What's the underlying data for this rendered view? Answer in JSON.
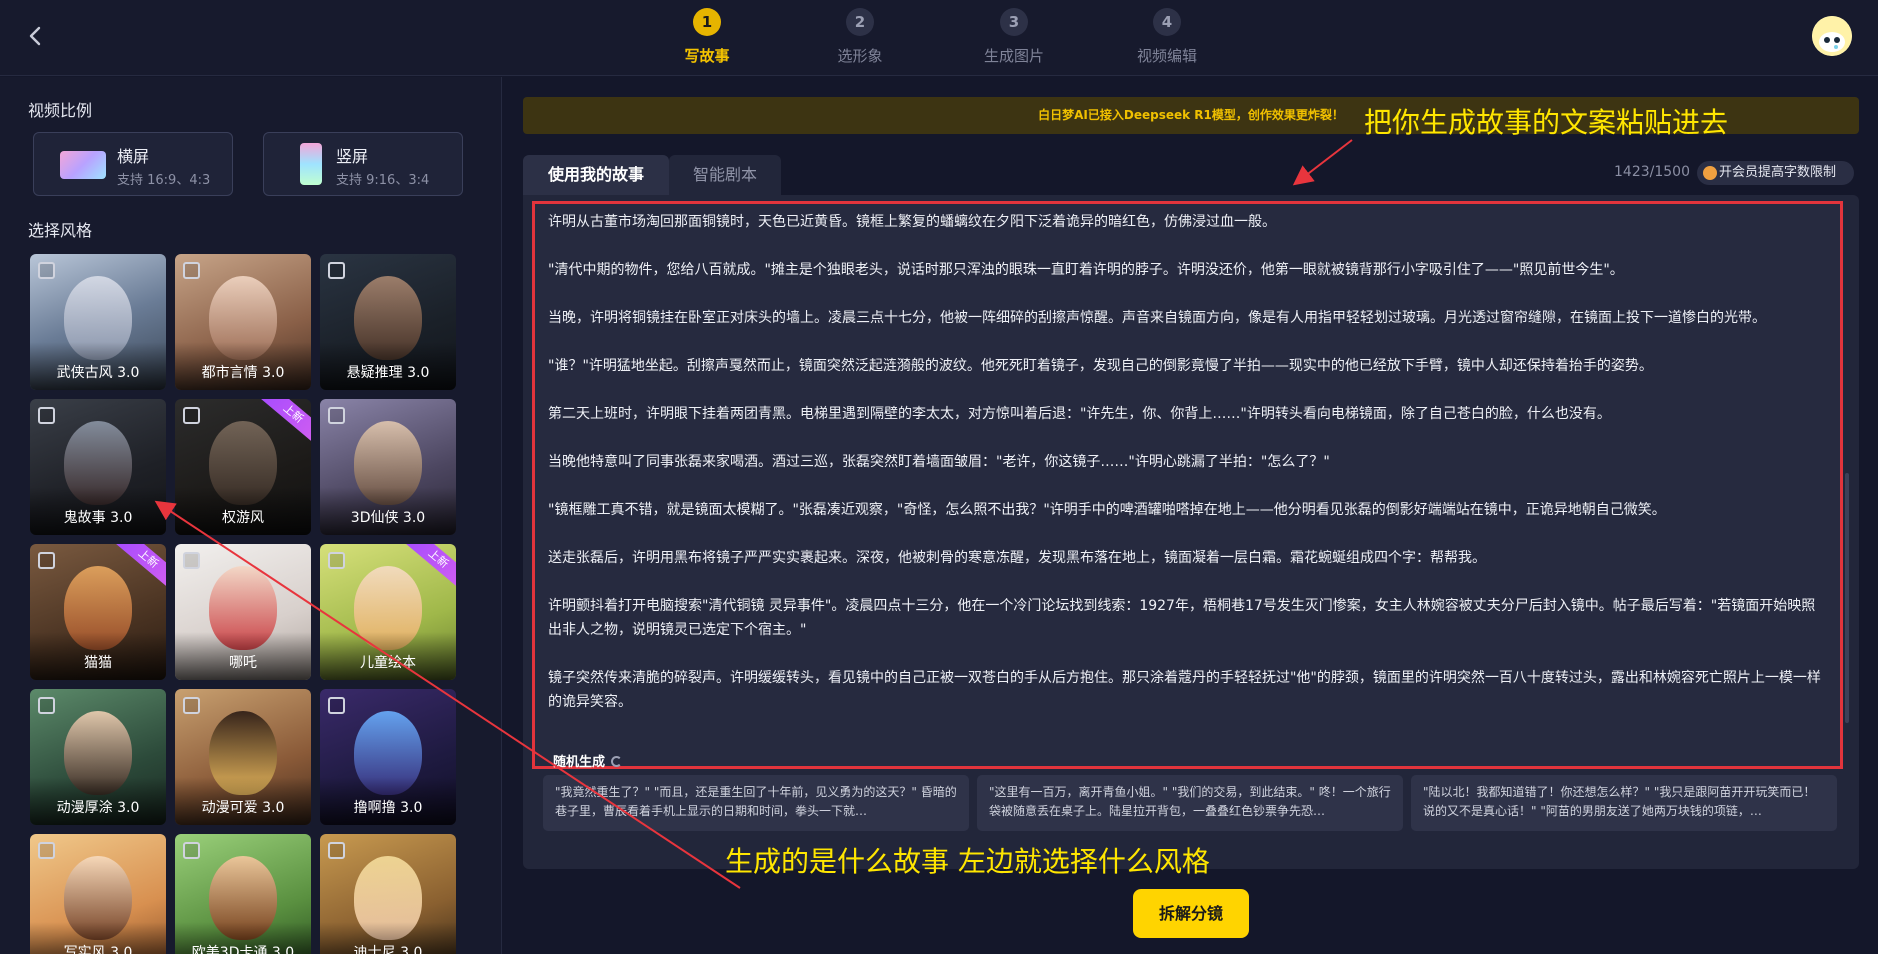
{
  "steps": [
    {
      "num": "1",
      "label": "写故事"
    },
    {
      "num": "2",
      "label": "选形象"
    },
    {
      "num": "3",
      "label": "生成图片"
    },
    {
      "num": "4",
      "label": "视频编辑"
    }
  ],
  "left": {
    "ratio_title": "视频比例",
    "ratios": [
      {
        "name": "横屏",
        "sub": "支持 16:9、4:3"
      },
      {
        "name": "竖屏",
        "sub": "支持 9:16、3:4"
      }
    ],
    "style_title": "选择风格",
    "styles": [
      {
        "label": "武侠古风 3.0",
        "badge": ""
      },
      {
        "label": "都市言情 3.0",
        "badge": ""
      },
      {
        "label": "悬疑推理 3.0",
        "badge": ""
      },
      {
        "label": "鬼故事 3.0",
        "badge": ""
      },
      {
        "label": "权游风",
        "badge": "上新"
      },
      {
        "label": "3D仙侠 3.0",
        "badge": ""
      },
      {
        "label": "猫猫",
        "badge": "上新"
      },
      {
        "label": "哪吒",
        "badge": ""
      },
      {
        "label": "儿童绘本",
        "badge": "上新"
      },
      {
        "label": "动漫厚涂 3.0",
        "badge": ""
      },
      {
        "label": "动漫可爱 3.0",
        "badge": ""
      },
      {
        "label": "撸啊撸 3.0",
        "badge": ""
      },
      {
        "label": "写实风 3.0",
        "badge": ""
      },
      {
        "label": "欧美3D卡通 3.0",
        "badge": ""
      },
      {
        "label": "迪士尼 3.0",
        "badge": ""
      }
    ]
  },
  "notice": "白日梦AI已接入Deepseek R1模型，创作效果更炸裂！",
  "tabs": [
    "使用我的故事",
    "智能剧本"
  ],
  "counter": "1423/1500",
  "member_button": "开会员提高字数限制",
  "story_paragraphs": [
    "许明从古董市场淘回那面铜镜时，天色已近黄昏。镜框上繁复的蟠螭纹在夕阳下泛着诡异的暗红色，仿佛浸过血一般。",
    "\"清代中期的物件，您给八百就成。\"摊主是个独眼老头，说话时那只浑浊的眼珠一直盯着许明的脖子。许明没还价，他第一眼就被镜背那行小字吸引住了——\"照见前世今生\"。",
    "当晚，许明将铜镜挂在卧室正对床头的墙上。凌晨三点十七分，他被一阵细碎的刮擦声惊醒。声音来自镜面方向，像是有人用指甲轻轻划过玻璃。月光透过窗帘缝隙，在镜面上投下一道惨白的光带。",
    "\"谁？\"许明猛地坐起。刮擦声戛然而止，镜面突然泛起涟漪般的波纹。他死死盯着镜子，发现自己的倒影竟慢了半拍——现实中的他已经放下手臂，镜中人却还保持着抬手的姿势。",
    "第二天上班时，许明眼下挂着两团青黑。电梯里遇到隔壁的李太太，对方惊叫着后退：\"许先生，你、你背上……\"许明转头看向电梯镜面，除了自己苍白的脸，什么也没有。",
    "当晚他特意叫了同事张磊来家喝酒。酒过三巡，张磊突然盯着墙面皱眉：\"老许，你这镜子……\"许明心跳漏了半拍：\"怎么了？\"",
    "\"镜框雕工真不错，就是镜面太模糊了。\"张磊凑近观察，\"奇怪，怎么照不出我？\"许明手中的啤酒罐啪嗒掉在地上——他分明看见张磊的倒影好端端站在镜中，正诡异地朝自己微笑。",
    "送走张磊后，许明用黑布将镜子严严实实裹起来。深夜，他被刺骨的寒意冻醒，发现黑布落在地上，镜面凝着一层白霜。霜花蜿蜒组成四个字：帮帮我。",
    "许明颤抖着打开电脑搜索\"清代铜镜 灵异事件\"。凌晨四点十三分，他在一个冷门论坛找到线索：1927年，梧桐巷17号发生灭门惨案，女主人林婉容被丈夫分尸后封入镜中。帖子最后写着：\"若镜面开始映照出非人之物，说明镜灵已选定下个宿主。\"",
    "镜子突然传来清脆的碎裂声。许明缓缓转头，看见镜中的自己正被一双苍白的手从后方抱住。那只涂着蔻丹的手轻轻抚过\"他\"的脖颈，镜面里的许明突然一百八十度转过头，露出和林婉容死亡照片上一模一样的诡异笑容。"
  ],
  "random_generate": "随机生成",
  "samples": [
    "\"我竟然重生了？\" \"而且，还是重生回了十年前，见义勇为的这天？\" 昏暗的巷子里，曹辰看着手机上显示的日期和时间，拳头一下就…",
    "\"这里有一百万，离开青鱼小姐。\" \"我们的交易，到此结束。\" 咚！一个旅行袋被随意丢在桌子上。陆星拉开背包，一叠叠红色钞票争先恐…",
    "\"陆以北！我都知道错了！你还想怎么样？\" \"我只是跟阿苗开开玩笑而已！说的又不是真心话！\" \"阿苗的男朋友送了她两万块钱的项链，…"
  ],
  "split_button": "拆解分镜",
  "annotations": {
    "top": "把你生成故事的文案粘贴进去",
    "bottom": "生成的是什么故事 左边就选择什么风格"
  },
  "colors": {
    "accent": "#ffd400",
    "highlight_box": "#e2343c",
    "annotation": "#ffe600"
  }
}
